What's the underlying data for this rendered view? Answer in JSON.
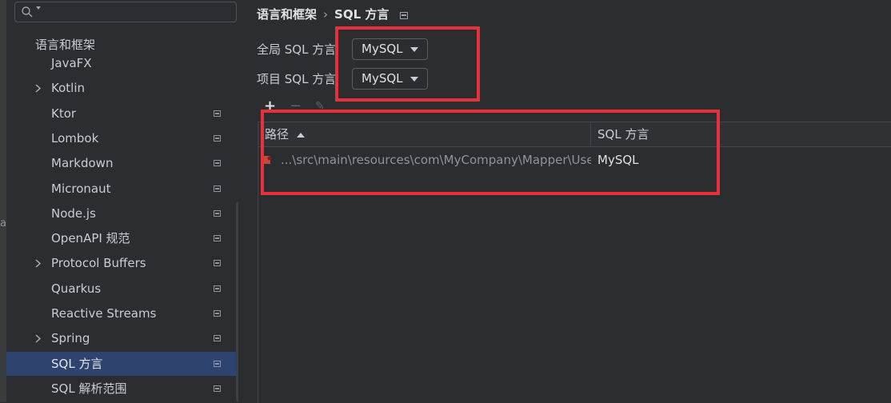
{
  "background_text": "ap",
  "sidebar": {
    "search": {
      "placeholder": ""
    },
    "group_title": "语言和框架",
    "items": [
      {
        "label": "JavaFX",
        "expandable": false,
        "modified": false,
        "selected": false
      },
      {
        "label": "Kotlin",
        "expandable": true,
        "modified": false,
        "selected": false
      },
      {
        "label": "Ktor",
        "expandable": false,
        "modified": true,
        "selected": false
      },
      {
        "label": "Lombok",
        "expandable": false,
        "modified": true,
        "selected": false
      },
      {
        "label": "Markdown",
        "expandable": false,
        "modified": true,
        "selected": false
      },
      {
        "label": "Micronaut",
        "expandable": false,
        "modified": true,
        "selected": false
      },
      {
        "label": "Node.js",
        "expandable": false,
        "modified": true,
        "selected": false
      },
      {
        "label": "OpenAPI 规范",
        "expandable": false,
        "modified": true,
        "selected": false
      },
      {
        "label": "Protocol Buffers",
        "expandable": true,
        "modified": true,
        "selected": false
      },
      {
        "label": "Quarkus",
        "expandable": false,
        "modified": true,
        "selected": false
      },
      {
        "label": "Reactive Streams",
        "expandable": false,
        "modified": true,
        "selected": false
      },
      {
        "label": "Spring",
        "expandable": true,
        "modified": true,
        "selected": false
      },
      {
        "label": "SQL 方言",
        "expandable": false,
        "modified": true,
        "selected": true
      },
      {
        "label": "SQL 解析范围",
        "expandable": false,
        "modified": true,
        "selected": false
      }
    ]
  },
  "breadcrumb": {
    "parent": "语言和框架",
    "separator": "›",
    "current": "SQL 方言"
  },
  "settings": {
    "global_dialect_label": "全局 SQL 方言",
    "global_dialect_value": "MySQL",
    "project_dialect_label": "项目 SQL 方言",
    "project_dialect_value": "MySQL"
  },
  "toolbar": {
    "add": "+",
    "remove": "−",
    "edit": "✎"
  },
  "table": {
    "columns": [
      "路径",
      "SQL 方言"
    ],
    "rows": [
      {
        "path": "...\\src\\main\\resources\\com\\MyCompany\\Mapper\\UserMapper.xml",
        "dialect": "MySQL"
      }
    ]
  },
  "colors": {
    "highlight": "#e8313a",
    "selection": "#2e436e",
    "background": "#2b2d30"
  }
}
